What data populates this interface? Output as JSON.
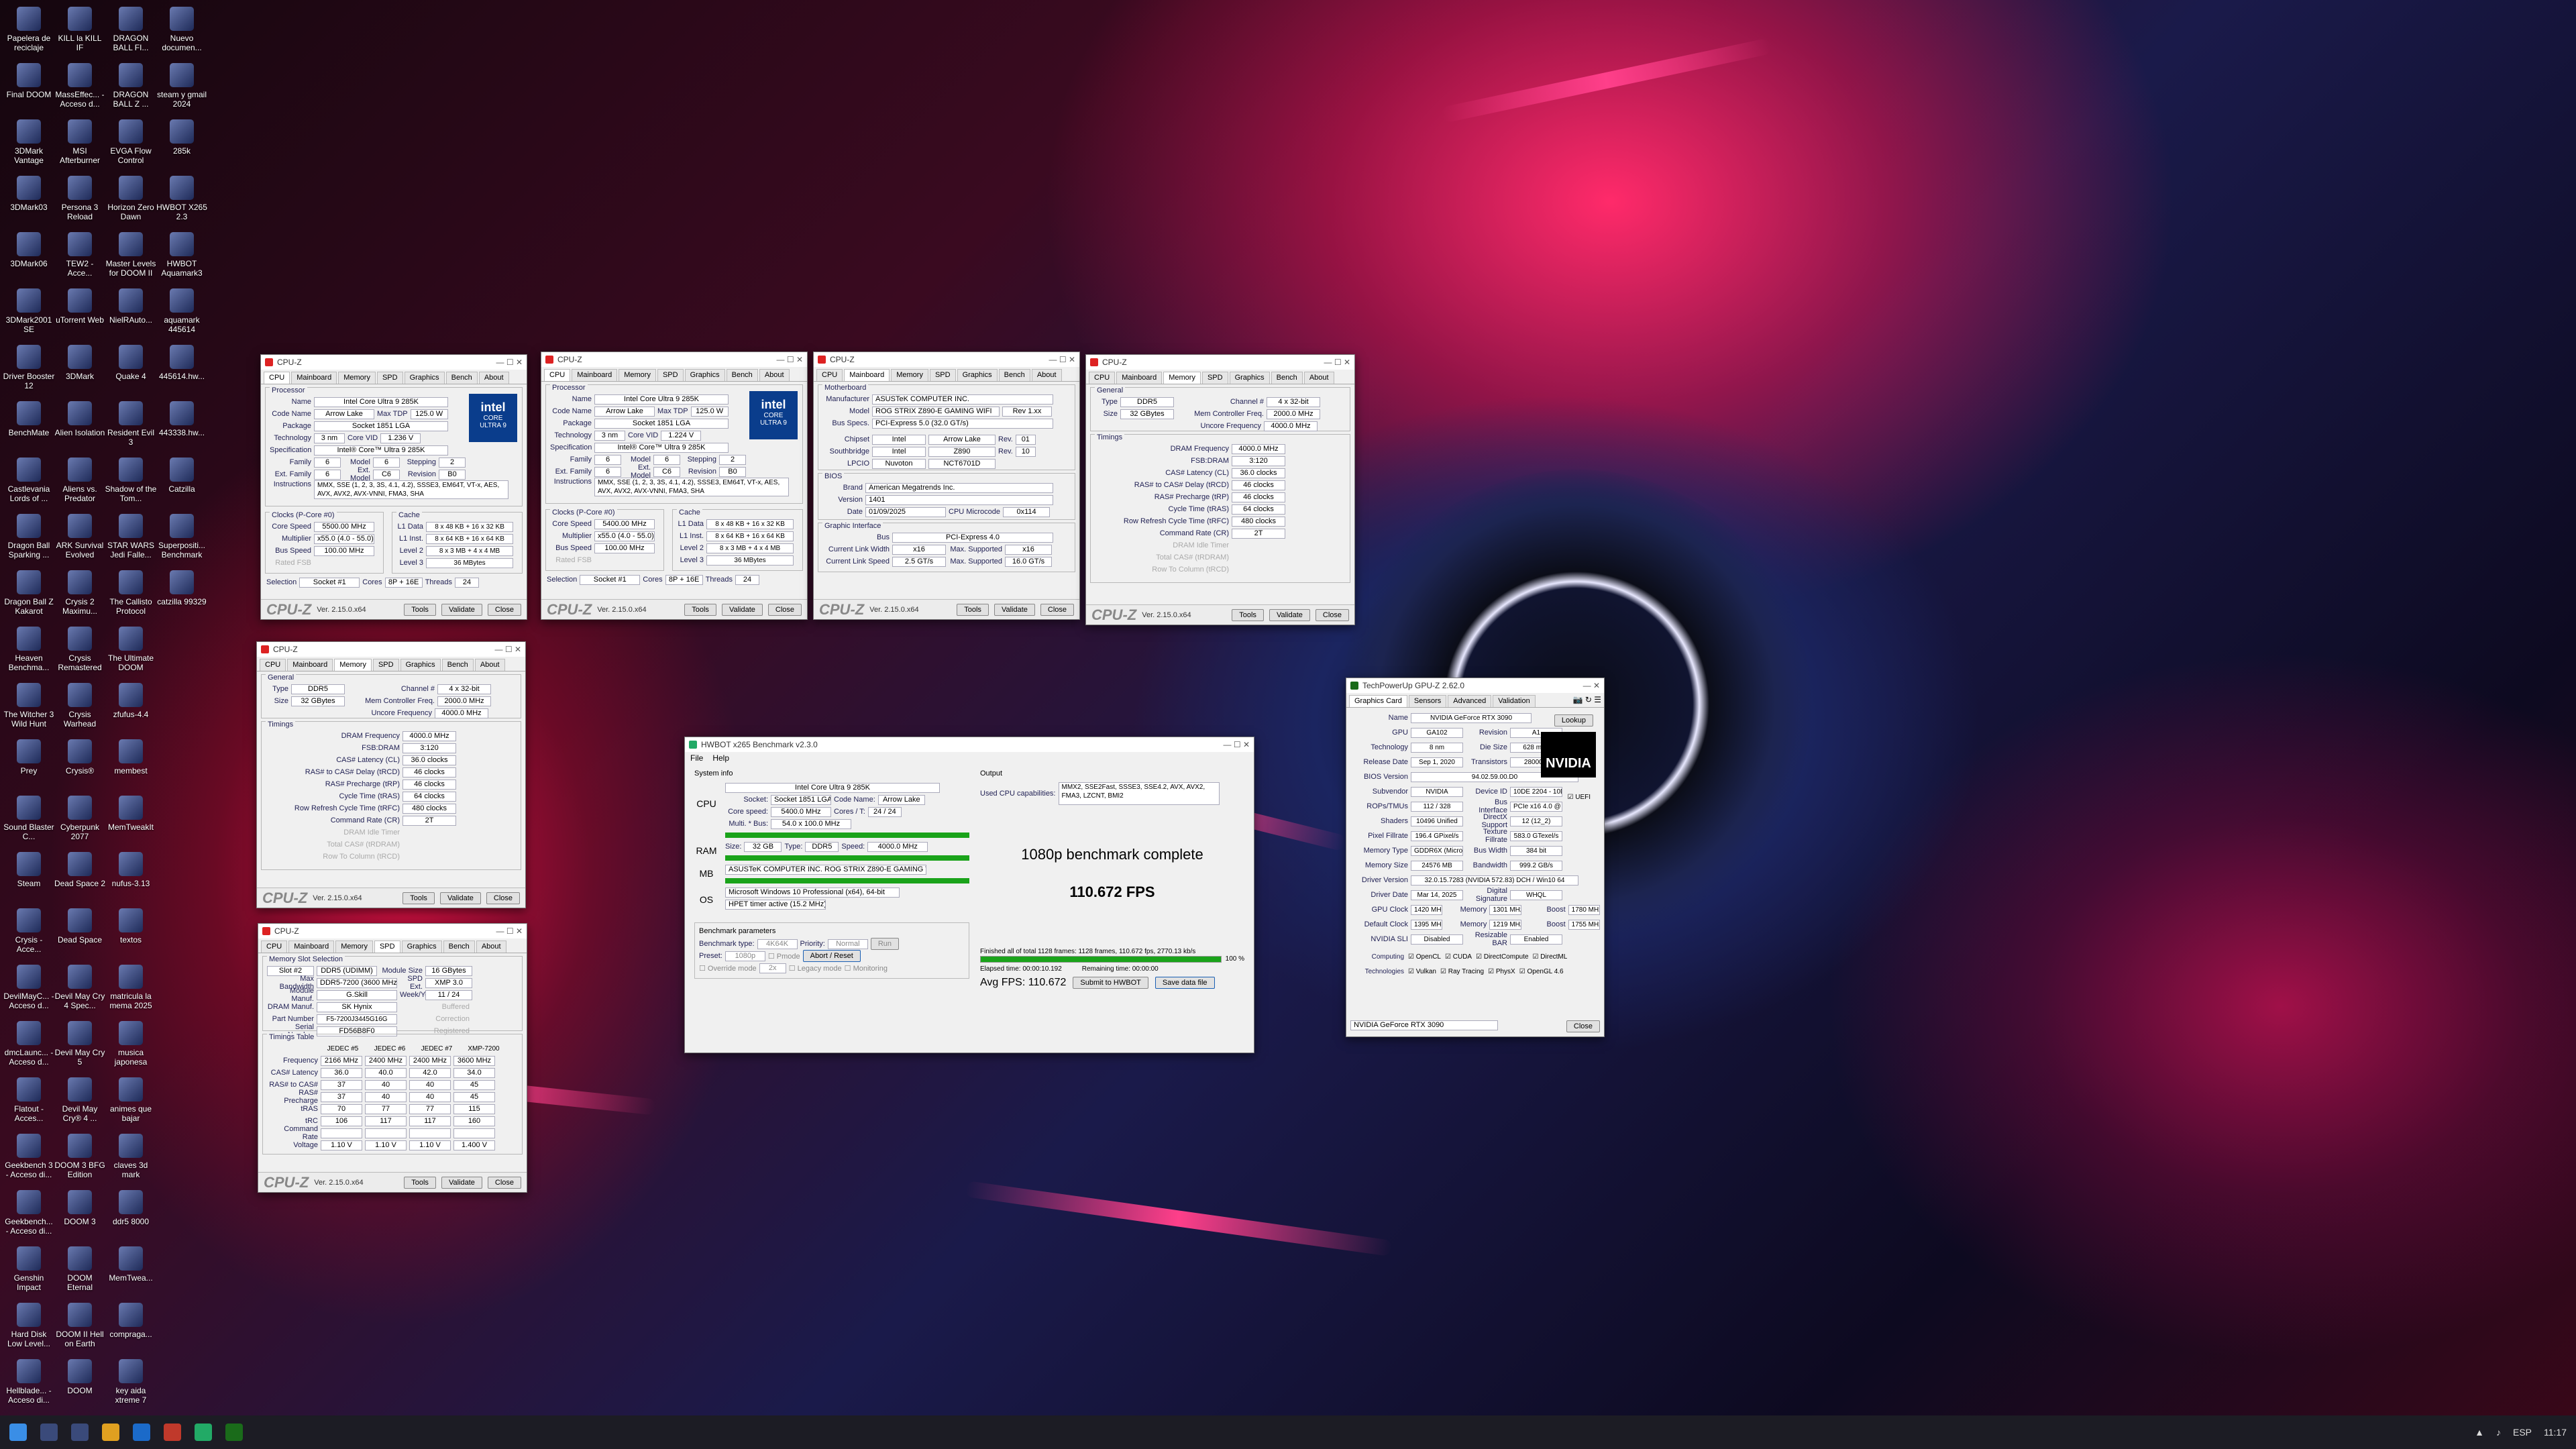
{
  "desktop": {
    "icons": [
      "Papelera de reciclaje",
      "KILL la KILL IF",
      "DRAGON BALL FI...",
      "Nuevo documen...",
      "Final DOOM",
      "MassEffec... - Acceso d...",
      "DRAGON BALL Z ...",
      "steam y gmail 2024",
      "3DMark Vantage",
      "MSI Afterburner",
      "EVGA Flow Control",
      "285k",
      "3DMark03",
      "Persona 3 Reload",
      "Horizon Zero Dawn",
      "HWBOT X265 2.3",
      "3DMark06",
      "TEW2 - Acce...",
      "Master Levels for DOOM II",
      "HWBOT Aquamark3",
      "3DMark2001 SE",
      "uTorrent Web",
      "NielRAuto...",
      "aquamark 445614",
      "Driver Booster 12",
      "3DMark",
      "Quake 4",
      "445614.hw...",
      "BenchMate",
      "Alien Isolation",
      "Resident Evil 3",
      "443338.hw...",
      "Castlevania Lords of ...",
      "Aliens vs. Predator",
      "Shadow of the Tom...",
      "Catzilla",
      "Dragon Ball Sparking ...",
      "ARK Survival Evolved",
      "STAR WARS Jedi Falle...",
      "Superpositi... Benchmark",
      "Dragon Ball Z Kakarot",
      "Crysis 2 Maximu...",
      "The Callisto Protocol",
      "catzilla 99329",
      "Heaven Benchma...",
      "Crysis Remastered",
      "The Ultimate DOOM",
      "",
      "The Witcher 3 Wild Hunt",
      "Crysis Warhead",
      "zfufus-4.4",
      "",
      "Prey",
      "Crysis®",
      "membest",
      "",
      "Sound Blaster C...",
      "Cyberpunk 2077",
      "MemTweakIt",
      "",
      "Steam",
      "Dead Space 2",
      "nufus-3.13",
      "",
      "Crysis - Acce...",
      "Dead Space",
      "textos",
      "",
      "DevilMayC... - Acceso d...",
      "Devil May Cry 4 Spec...",
      "matricula la mema 2025",
      "",
      "dmcLaunc... - Acceso d...",
      "Devil May Cry 5",
      "musica japonesa",
      "",
      "Flatout - Acces...",
      "Devil May Cry® 4 ...",
      "animes que bajar",
      "",
      "Geekbench 3 - Acceso di...",
      "DOOM 3 BFG Edition",
      "claves 3d mark",
      "",
      "Geekbench... - Acceso di...",
      "DOOM 3",
      "ddr5 8000",
      "",
      "Genshin Impact",
      "DOOM Eternal",
      "MemTwea...",
      "",
      "Hard Disk Low Level...",
      "DOOM II Hell on Earth",
      "compraga...",
      "",
      "Hellblade... - Acceso di...",
      "DOOM",
      "key aida xtreme 7",
      ""
    ]
  },
  "cpuz": {
    "title": "CPU-Z",
    "tabs": [
      "CPU",
      "Mainboard",
      "Memory",
      "SPD",
      "Graphics",
      "Bench",
      "About"
    ],
    "version": "Ver. 2.15.0.x64",
    "tools": "Tools",
    "validate": "Validate",
    "close": "Close",
    "cpu": {
      "section": "Processor",
      "name_k": "Name",
      "name": "Intel Core Ultra 9 285K",
      "codename_k": "Code Name",
      "codename": "Arrow Lake",
      "maxtdp_k": "Max TDP",
      "maxtdp": "125.0 W",
      "package_k": "Package",
      "package": "Socket 1851 LGA",
      "tech_k": "Technology",
      "tech": "3 nm",
      "corevid_k": "Core VID",
      "corevid1": "1.236 V",
      "corevid2": "1.224 V",
      "spec_k": "Specification",
      "spec": "Intel® Core™ Ultra 9 285K",
      "family_k": "Family",
      "family": "6",
      "model_k": "Model",
      "model": "6",
      "stepping_k": "Stepping",
      "stepping": "2",
      "extfam_k": "Ext. Family",
      "extfam": "6",
      "extmod_k": "Ext. Model",
      "extmod": "C6",
      "rev_k": "Revision",
      "rev": "B0",
      "instr_k": "Instructions",
      "instr": "MMX, SSE (1, 2, 3, 3S, 4.1, 4.2), SSSE3, EM64T, VT-x, AES, AVX, AVX2, AVX-VNNI, FMA3, SHA",
      "clocks": "Clocks (P-Core #0)",
      "cache": "Cache",
      "corespeed_k": "Core Speed",
      "corespeed1": "5500.00 MHz",
      "corespeed2": "5400.00 MHz",
      "mult_k": "Multiplier",
      "mult": "x55.0 (4.0 - 55.0)",
      "mult2": "x55.0 (4.0 - 55.0)",
      "bus_k": "Bus Speed",
      "bus": "100.00 MHz",
      "ratedfsb_k": "Rated FSB",
      "l1d_k": "L1 Data",
      "l1d": "8 x 48 KB + 16 x 32 KB",
      "l1i_k": "L1 Inst.",
      "l1i": "8 x 64 KB + 16 x 64 KB",
      "l2_k": "Level 2",
      "l2": "8 x 3 MB + 4 x 4 MB",
      "l3_k": "Level 3",
      "l3": "36 MBytes",
      "selection_k": "Selection",
      "selection": "Socket #1",
      "cores_k": "Cores",
      "cores": "8P + 16E",
      "threads_k": "Threads",
      "threads": "24",
      "intel": "intel",
      "intel_sub": "CORE",
      "intel_tag": "ULTRA 9"
    },
    "mainboard": {
      "section": "Motherboard",
      "manu_k": "Manufacturer",
      "manu": "ASUSTeK COMPUTER INC.",
      "model_k": "Model",
      "model": "ROG STRIX Z890-E GAMING WIFI",
      "rev": "Rev 1.xx",
      "busspecs_k": "Bus Specs.",
      "busspecs": "PCI-Express 5.0 (32.0 GT/s)",
      "chipset_k": "Chipset",
      "chipset": "Intel",
      "chipset2": "Arrow Lake",
      "chiprev_k": "Rev.",
      "chiprev": "01",
      "south_k": "Southbridge",
      "south": "Intel",
      "south2": "Z890",
      "southrev": "10",
      "lpcio_k": "LPCIO",
      "lpcio": "Nuvoton",
      "lpcio2": "NCT6701D",
      "bios": "BIOS",
      "brand_k": "Brand",
      "brand": "American Megatrends Inc.",
      "version_k": "Version",
      "version": "1401",
      "date_k": "Date",
      "date": "01/09/2025",
      "micro_k": "CPU Microcode",
      "micro": "0x114",
      "gi": "Graphic Interface",
      "gbus_k": "Bus",
      "gbus": "PCI-Express 4.0",
      "clw_k": "Current Link Width",
      "clw": "x16",
      "msup_k": "Max. Supported",
      "msup": "x16",
      "cls_k": "Current Link Speed",
      "cls": "2.5 GT/s",
      "mss": "16.0 GT/s"
    },
    "memory": {
      "general": "General",
      "type_k": "Type",
      "type": "DDR5",
      "channel_k": "Channel #",
      "channel": "4 x 32-bit",
      "size_k": "Size",
      "size": "32 GBytes",
      "mcf_k": "Mem Controller Freq.",
      "mcf": "2000.0 MHz",
      "uncore_k": "Uncore Frequency",
      "uncore": "4000.0 MHz",
      "timings": "Timings",
      "t": [
        [
          "DRAM Frequency",
          "4000.0 MHz"
        ],
        [
          "FSB:DRAM",
          "3:120"
        ],
        [
          "CAS# Latency (CL)",
          "36.0 clocks"
        ],
        [
          "RAS# to CAS# Delay (tRCD)",
          "46 clocks"
        ],
        [
          "RAS# Precharge (tRP)",
          "46 clocks"
        ],
        [
          "Cycle Time (tRAS)",
          "64 clocks"
        ],
        [
          "Row Refresh Cycle Time (tRFC)",
          "480 clocks"
        ],
        [
          "Command Rate (CR)",
          "2T"
        ],
        [
          "DRAM Idle Timer",
          ""
        ],
        [
          "Total CAS# (tRDRAM)",
          ""
        ],
        [
          "Row To Column (tRCD)",
          ""
        ]
      ]
    },
    "spd": {
      "group": "Memory Slot Selection",
      "slot": "Slot #2",
      "slotval": "DDR5 (UDIMM)",
      "modsize_k": "Module Size",
      "modsize": "16 GBytes",
      "maxbw_k": "Max Bandwidth",
      "maxbw": "DDR5-7200 (3600 MHz)",
      "spdext_k": "SPD Ext.",
      "spdext": "XMP 3.0",
      "modmanuf_k": "Module Manuf.",
      "modmanuf": "G.Skill",
      "week_k": "Week/Year",
      "week": "11 / 24",
      "drammanuf_k": "DRAM Manuf.",
      "drammanuf": "SK Hynix",
      "buffered_k": "Buffered",
      "part_k": "Part Number",
      "part": "F5-7200J3445G16G",
      "correction_k": "Correction",
      "serial_k": "Serial Number",
      "serial": "FD56B8F0",
      "registered_k": "Registered",
      "ttable": "Timings Table",
      "cols": [
        "JEDEC #5",
        "JEDEC #6",
        "JEDEC #7",
        "XMP-7200"
      ],
      "rows": [
        [
          "Frequency",
          "2166 MHz",
          "2400 MHz",
          "2400 MHz",
          "3600 MHz"
        ],
        [
          "CAS# Latency",
          "36.0",
          "40.0",
          "42.0",
          "34.0"
        ],
        [
          "RAS# to CAS#",
          "37",
          "40",
          "40",
          "45"
        ],
        [
          "RAS# Precharge",
          "37",
          "40",
          "40",
          "45"
        ],
        [
          "tRAS",
          "70",
          "77",
          "77",
          "115"
        ],
        [
          "tRC",
          "106",
          "117",
          "117",
          "160"
        ],
        [
          "Command Rate",
          "",
          "",
          "",
          ""
        ],
        [
          "Voltage",
          "1.10 V",
          "1.10 V",
          "1.10 V",
          "1.400 V"
        ]
      ]
    }
  },
  "hwbot": {
    "title": "HWBOT x265 Benchmark v2.3.0",
    "menu": [
      "File",
      "Help"
    ],
    "sysinfo": "System info",
    "output": "Output",
    "cpu_l": "CPU",
    "cpu": "Intel Core Ultra 9 285K",
    "socket_k": "Socket:",
    "socket": "Socket 1851 LGA",
    "codename_k": "Code Name:",
    "codename": "Arrow Lake",
    "corespeed_k": "Core speed:",
    "corespeed": "5400.0 MHz",
    "cores_k": "Cores / T:",
    "cores": "24 / 24",
    "multi_k": "Multi. * Bus:",
    "multi": "54.0 x 100.0 MHz",
    "ram_l": "RAM",
    "size_k": "Size:",
    "size": "32 GB",
    "type_k": "Type:",
    "type": "DDR5",
    "speed_k": "Speed:",
    "speed": "4000.0 MHz",
    "mb_l": "MB",
    "mb": "ASUSTeK COMPUTER INC. ROG STRIX Z890-E GAMING WIFI",
    "os_l": "OS",
    "os": "Microsoft Windows 10 Professional (x64), 64-bit",
    "timer": "HPET timer active (15.2 MHz)",
    "caps_k": "Used CPU capabilities:",
    "caps": "MMX2, SSE2Fast, SSSE3, SSE4.2, AVX, AVX2, FMA3, LZCNT, BMI2",
    "complete": "1080p benchmark complete",
    "fps": "110.672 FPS",
    "params": "Benchmark parameters",
    "bt_k": "Benchmark type:",
    "bt": "4K64K",
    "prio_k": "Priority:",
    "prio": "Normal",
    "run": "Run",
    "preset_k": "Preset:",
    "preset": "1080p",
    "pmode": "Pmode",
    "abort": "Abort / Reset",
    "override": "Override mode",
    "overval": "2x",
    "legacy": "Legacy mode",
    "monitoring": "Monitoring",
    "finished": "Finished all of total 1128 frames: 1128 frames, 110.672 fps, 2770.13 kb/s",
    "pct": "100 %",
    "elapsed": "Elapsed time: 00:00:10.192",
    "remaining": "Remaining time: 00:00:00",
    "avg": "Avg FPS: 110.672",
    "submit": "Submit to HWBOT",
    "save": "Save data file",
    "progress": 1.0
  },
  "gpuz": {
    "title": "TechPowerUp GPU-Z 2.62.0",
    "tabs": [
      "Graphics Card",
      "Sensors",
      "Advanced",
      "Validation"
    ],
    "lookup": "Lookup",
    "uefi": "UEFI",
    "nvidia": "NVIDIA",
    "rows": [
      [
        "Name",
        "NVIDIA GeForce RTX 3090"
      ],
      [
        "GPU",
        "GA102",
        "Revision",
        "A1"
      ],
      [
        "Technology",
        "8 nm",
        "Die Size",
        "628 mm²"
      ],
      [
        "Release Date",
        "Sep 1, 2020",
        "Transistors",
        "28000M"
      ],
      [
        "BIOS Version",
        "94.02.59.00.D0"
      ],
      [
        "Subvendor",
        "NVIDIA",
        "Device ID",
        "10DE 2204 - 10DE 1454"
      ],
      [
        "ROPs/TMUs",
        "112 / 328",
        "Bus Interface",
        "PCIe x16 4.0 @ x16 1.1"
      ],
      [
        "Shaders",
        "10496 Unified",
        "DirectX Support",
        "12 (12_2)"
      ],
      [
        "Pixel Fillrate",
        "196.4 GPixel/s",
        "Texture Fillrate",
        "583.0 GTexel/s"
      ],
      [
        "Memory Type",
        "GDDR6X (Micron)",
        "Bus Width",
        "384 bit"
      ],
      [
        "Memory Size",
        "24576 MB",
        "Bandwidth",
        "999.2 GB/s"
      ],
      [
        "Driver Version",
        "32.0.15.7283 (NVIDIA 572.83) DCH / Win10 64"
      ],
      [
        "Driver Date",
        "Mar 14, 2025",
        "Digital Signature",
        "WHQL"
      ],
      [
        "GPU Clock",
        "1420 MHz",
        "Memory",
        "1301 MHz",
        "Boost",
        "1780 MHz"
      ],
      [
        "Default Clock",
        "1395 MHz",
        "Memory",
        "1219 MHz",
        "Boost",
        "1755 MHz"
      ],
      [
        "NVIDIA SLI",
        "Disabled",
        "Resizable BAR",
        "Enabled"
      ]
    ],
    "computing_k": "Computing",
    "computing": [
      "OpenCL",
      "CUDA",
      "DirectCompute",
      "DirectML"
    ],
    "tech_k": "Technologies",
    "tech": [
      "Vulkan",
      "Ray Tracing",
      "PhysX",
      "OpenGL 4.6"
    ],
    "select": "NVIDIA GeForce RTX 3090",
    "close": "Close"
  },
  "taskbar": {
    "lang": "ESP",
    "time": "11:17"
  }
}
